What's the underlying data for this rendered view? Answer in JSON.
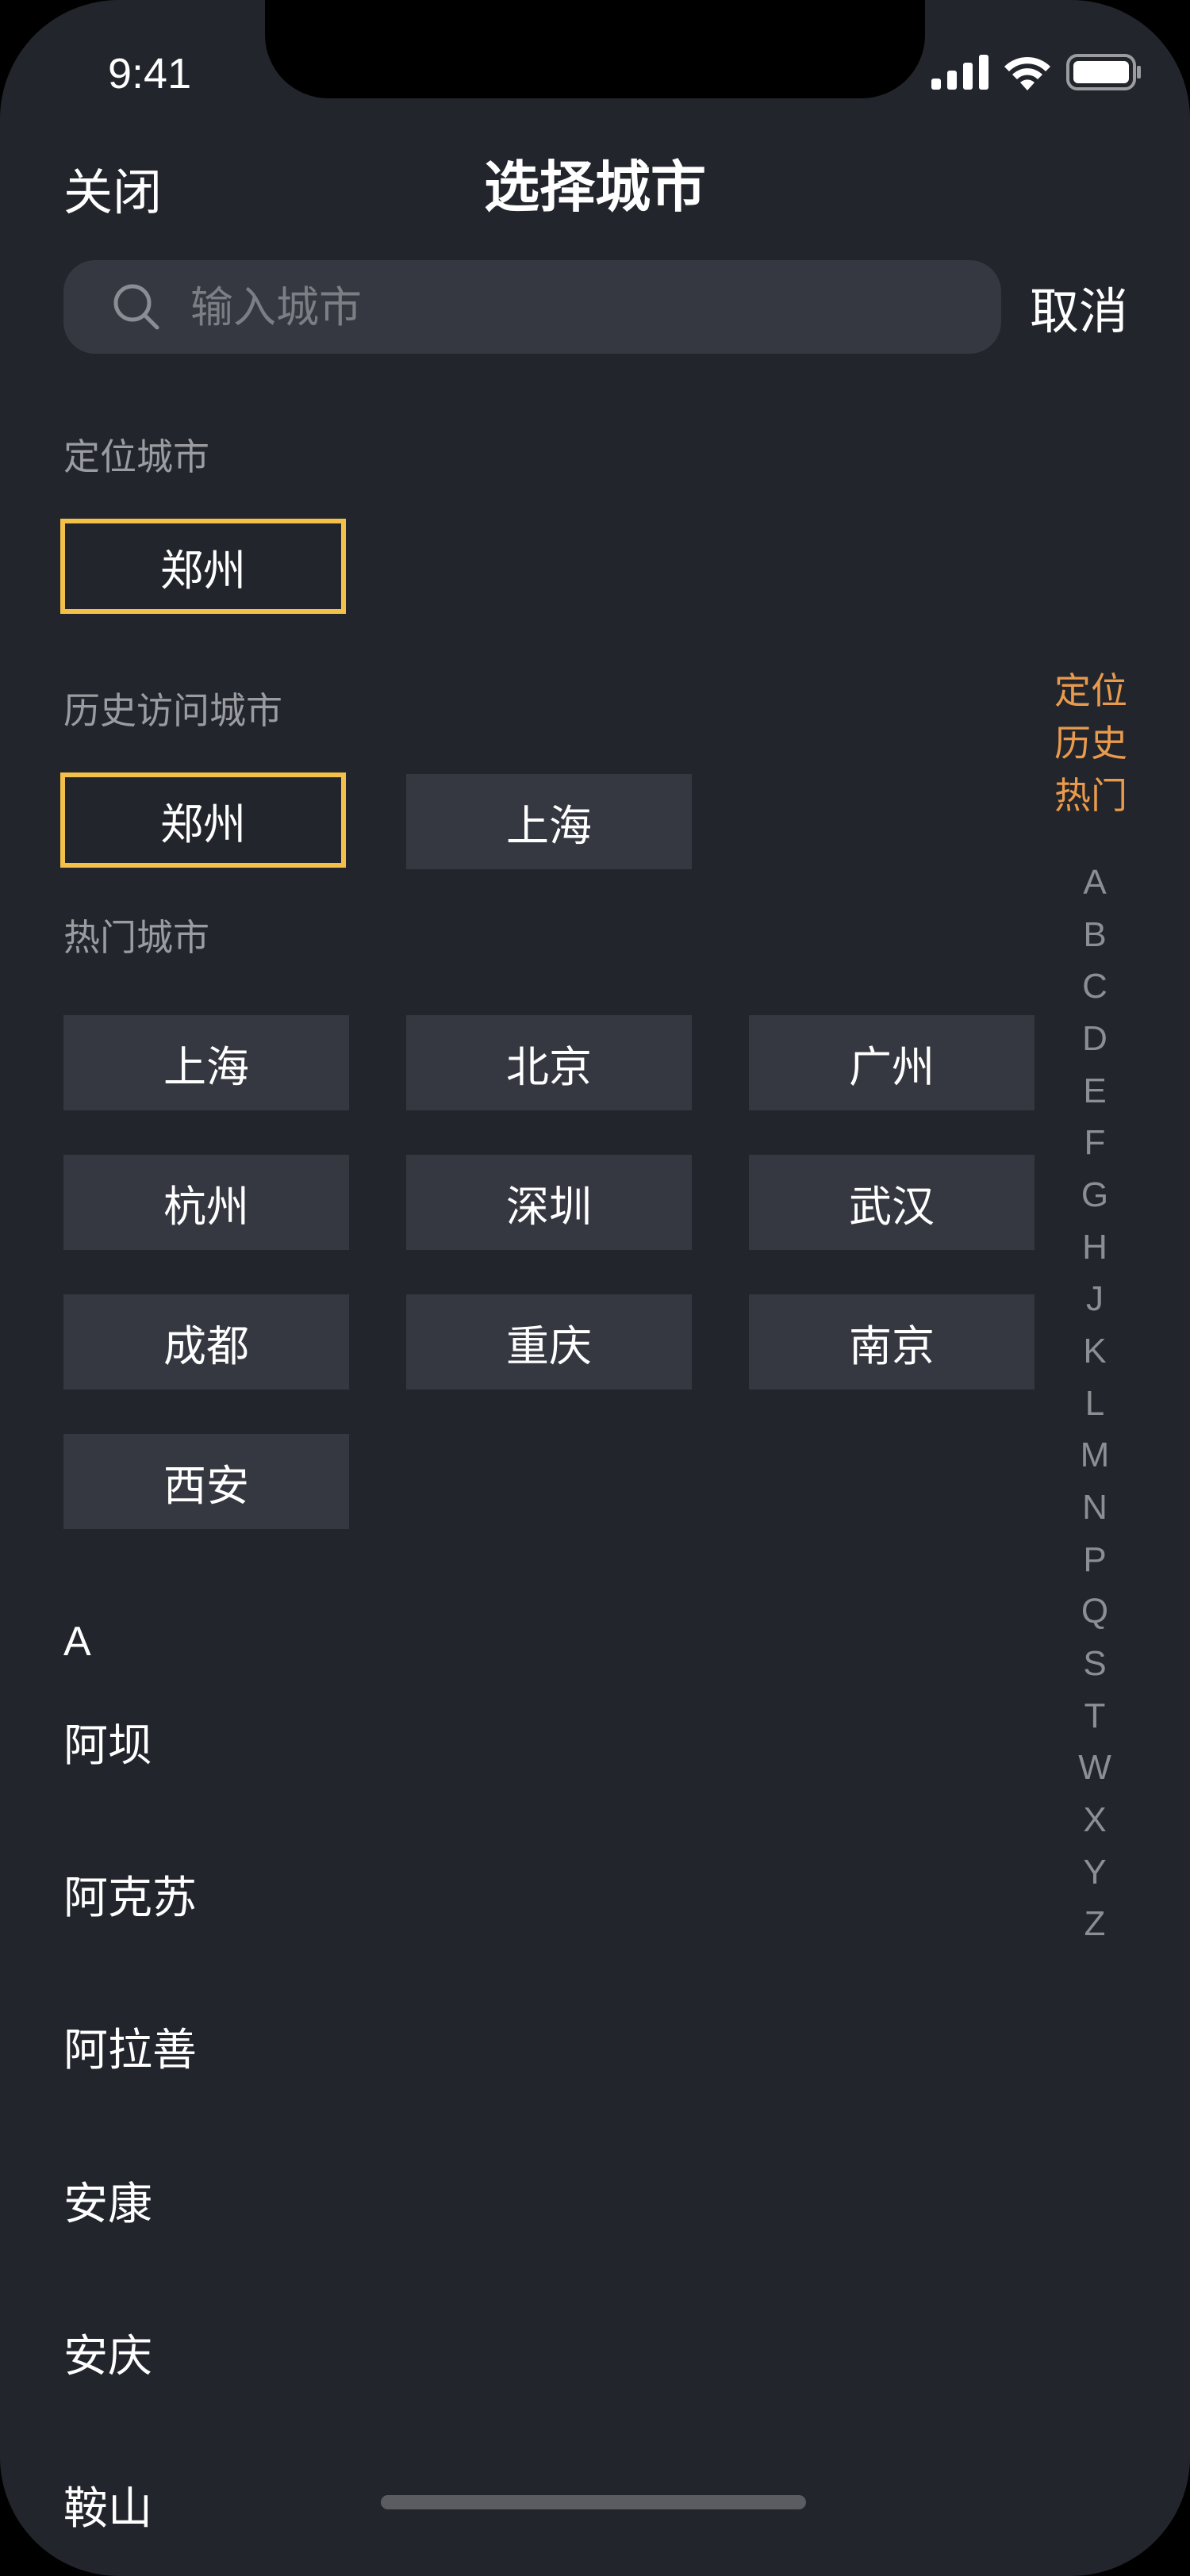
{
  "status_bar": {
    "time": "9:41"
  },
  "header": {
    "close_label": "关闭",
    "title": "选择城市",
    "cancel_label": "取消"
  },
  "search": {
    "placeholder": "输入城市",
    "value": ""
  },
  "location_section": {
    "label": "定位城市",
    "city": "郑州"
  },
  "history_section": {
    "label": "历史访问城市",
    "cities": [
      "郑州",
      "上海"
    ]
  },
  "hot_section": {
    "label": "热门城市",
    "cities": [
      "上海",
      "北京",
      "广州",
      "杭州",
      "深圳",
      "武汉",
      "成都",
      "重庆",
      "南京",
      "西安"
    ]
  },
  "city_list": {
    "group_letter": "A",
    "cities": [
      "阿坝",
      "阿克苏",
      "阿拉善",
      "安康",
      "安庆",
      "鞍山"
    ]
  },
  "index_bar": {
    "top_items": [
      "定位",
      "历史",
      "热门"
    ],
    "letters": [
      "A",
      "B",
      "C",
      "D",
      "E",
      "F",
      "G",
      "H",
      "J",
      "K",
      "L",
      "M",
      "N",
      "P",
      "Q",
      "S",
      "T",
      "W",
      "X",
      "Y",
      "Z"
    ]
  },
  "colors": {
    "background": "#22252c",
    "chip": "#353840",
    "selected_border": "#f3c14a",
    "index_accent": "#e99a4c"
  }
}
